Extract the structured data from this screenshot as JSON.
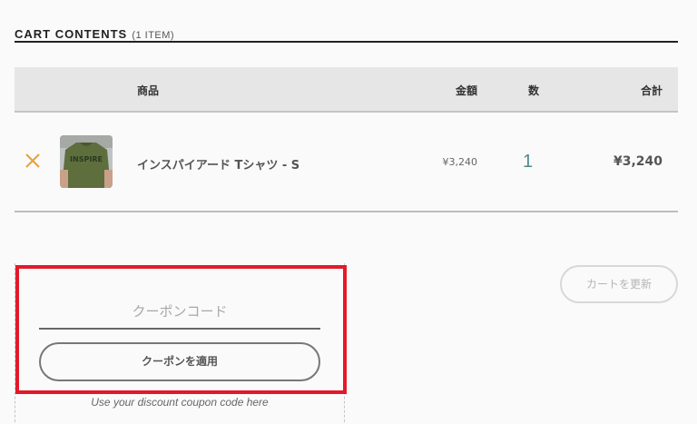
{
  "cart": {
    "title": "CART CONTENTS",
    "count": "(1 ITEM)"
  },
  "table": {
    "headers": {
      "product": "商品",
      "price": "金額",
      "quantity": "数",
      "total": "合計"
    },
    "items": [
      {
        "name": "インスパイアード Tシャツ - S",
        "price": "¥3,240",
        "quantity": "1",
        "total": "¥3,240",
        "thumbnail_text": "INSPIRE"
      }
    ]
  },
  "actions": {
    "update_cart": "カートを更新"
  },
  "coupon": {
    "placeholder": "クーポンコード",
    "value": "",
    "apply_label": "クーポンを適用",
    "hint": "Use your discount coupon code here"
  },
  "colors": {
    "accent_remove": "#e8a13a",
    "highlight_border": "#e3192a",
    "quantity_text": "#4f8a8a"
  },
  "icons": {
    "remove": "close-icon"
  }
}
